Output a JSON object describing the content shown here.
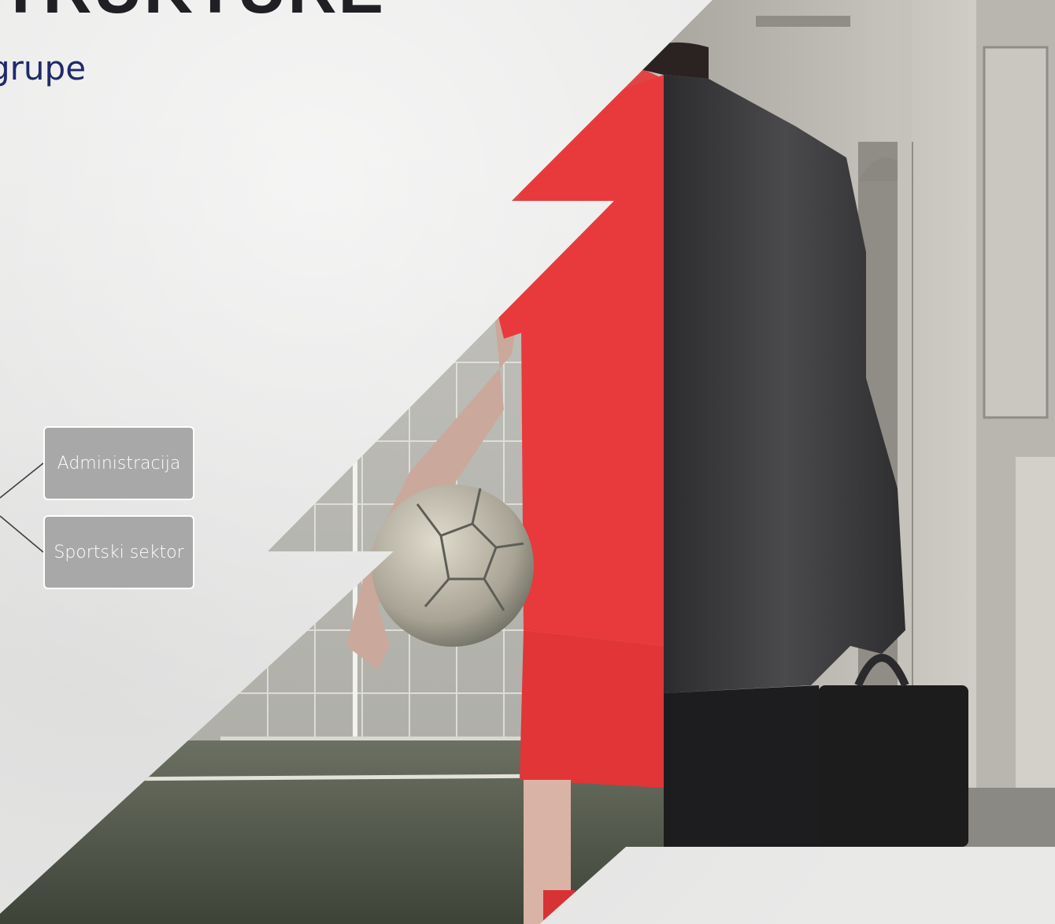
{
  "slide": {
    "heading_partial": "TRUKTURE",
    "subtitle_partial": "grupe"
  },
  "org_chart": {
    "nodes": [
      {
        "id": "administracija",
        "label": "Administracija"
      },
      {
        "id": "sportski-sektor",
        "label": "Sportski sektor"
      }
    ]
  },
  "image": {
    "subject": "split-figure-athlete-businessman",
    "accent_color": "#e8393c",
    "suit_color": "#3b3b3d"
  },
  "colors": {
    "background": "#e9e9e8",
    "subtitle": "#1f2a6b",
    "node_fill": "#a8a8a8",
    "node_border": "#ffffff"
  }
}
